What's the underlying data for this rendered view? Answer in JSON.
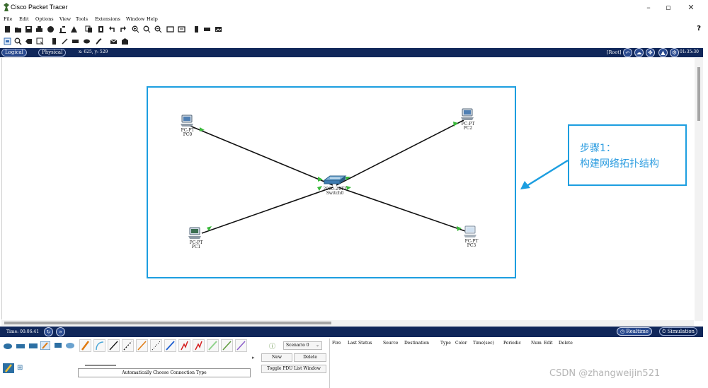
{
  "window": {
    "title": "Cisco Packet Tracer",
    "minimize": "–",
    "maximize": "▫",
    "close": "✕"
  },
  "menu": [
    "File",
    "Edit",
    "Options",
    "View",
    "Tools",
    "Extensions",
    "Window",
    "Help"
  ],
  "help_label": "?",
  "logical_bar": {
    "logical_tab": "Logical",
    "physical_tab": "Physical",
    "coords": "x: 625, y: 529",
    "root_label": "[Root]",
    "clock": "01:35:30"
  },
  "devices": [
    {
      "type": "PC-PT",
      "name": "PC0"
    },
    {
      "type": "PC-PT",
      "name": "PC1"
    },
    {
      "type": "PC-PT",
      "name": "PC2"
    },
    {
      "type": "PC-PT",
      "name": "PC3"
    },
    {
      "type": "2960-24TT",
      "name": "Switch0"
    }
  ],
  "callout": {
    "line1": "步骤1：",
    "line2": "构建网络拓扑结构"
  },
  "colors": {
    "accent_blue": "#1c9ee0",
    "dark_bar": "#10275a",
    "link_light": "#3ab83a"
  },
  "timebar": {
    "time_label": "Time: 00:06:41",
    "realtime": "Realtime",
    "simulation": "Simulation"
  },
  "bottom": {
    "connection_type": "Automatically Choose Connection Type",
    "scenario": "Scenario 0",
    "new_button": "New",
    "delete_button": "Delete",
    "toggle_button": "Toggle PDU List Window",
    "pdu_columns": [
      "Fire",
      "Last Status",
      "Source",
      "Destination",
      "Type",
      "Color",
      "Time(sec)",
      "Periodic",
      "Num",
      "Edit",
      "Delete"
    ]
  },
  "watermark": "CSDN @zhangweijin521"
}
